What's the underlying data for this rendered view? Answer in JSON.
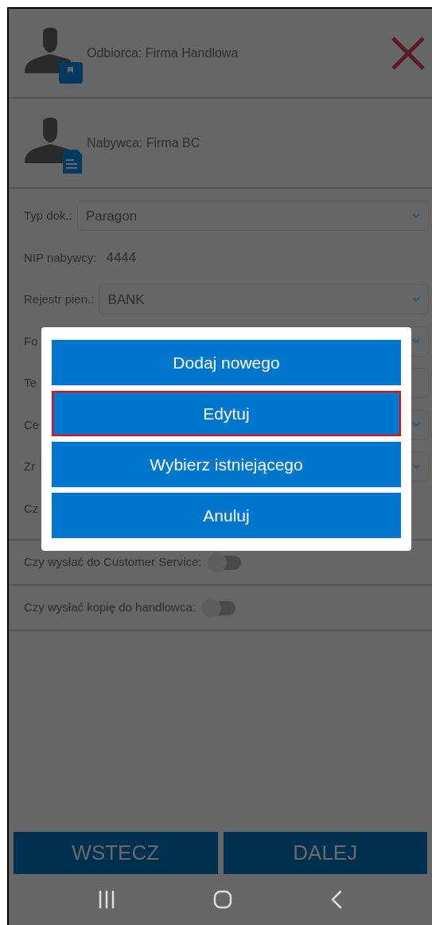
{
  "header": [
    {
      "kind": "recipient",
      "label": "Odbiorca: Firma Handlowa",
      "closable": true
    },
    {
      "kind": "buyer",
      "label": "Nabywca: Firma BC",
      "closable": false
    }
  ],
  "form": [
    {
      "kind": "select",
      "label": "Typ dok.:",
      "value": "Paragon"
    },
    {
      "kind": "text",
      "label": "NIP nabywcy:",
      "value": "4444"
    },
    {
      "kind": "select",
      "label": "Rejestr pien.:",
      "value": "BANK"
    },
    {
      "kind": "select",
      "label": "Fo"
    },
    {
      "kind": "input",
      "label": "Te"
    },
    {
      "kind": "select",
      "label": "Ce"
    },
    {
      "kind": "select",
      "label": "Zr"
    },
    {
      "kind": "text",
      "label": "Cz"
    }
  ],
  "toggles": [
    {
      "label": "Czy wysłać do Customer Service:",
      "on": false
    },
    {
      "label": "Czy wysłać kopię do handlowca:",
      "on": false
    }
  ],
  "dialog": {
    "options": [
      {
        "label": "Dodaj nowego",
        "highlighted": false
      },
      {
        "label": "Edytuj",
        "highlighted": true
      },
      {
        "label": "Wybierz istniejącego",
        "highlighted": false
      },
      {
        "label": "Anuluj",
        "highlighted": false
      }
    ]
  },
  "footer": [
    {
      "label": "WSTECZ"
    },
    {
      "label": "DALEJ"
    }
  ]
}
